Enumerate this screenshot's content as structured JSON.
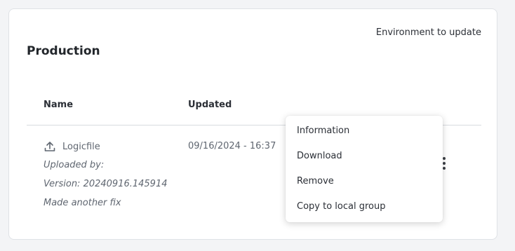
{
  "environment_label": "Environment to update",
  "section_title": "Production",
  "table": {
    "columns": [
      "Name",
      "Updated"
    ],
    "row": {
      "icon": "upload-icon",
      "file_name": "Logicfile",
      "uploaded_by": "Uploaded by:",
      "version": "Version: 20240916.145914",
      "note": "Made another fix",
      "updated": "09/16/2024 - 16:37"
    }
  },
  "menu": {
    "items": [
      "Information",
      "Download",
      "Remove",
      "Copy to local group"
    ]
  },
  "colors": {
    "background": "#f3f4f6",
    "card": "#ffffff",
    "text": "#2b2f36",
    "muted_text": "#5f6670",
    "divider": "#d8dbe0"
  }
}
